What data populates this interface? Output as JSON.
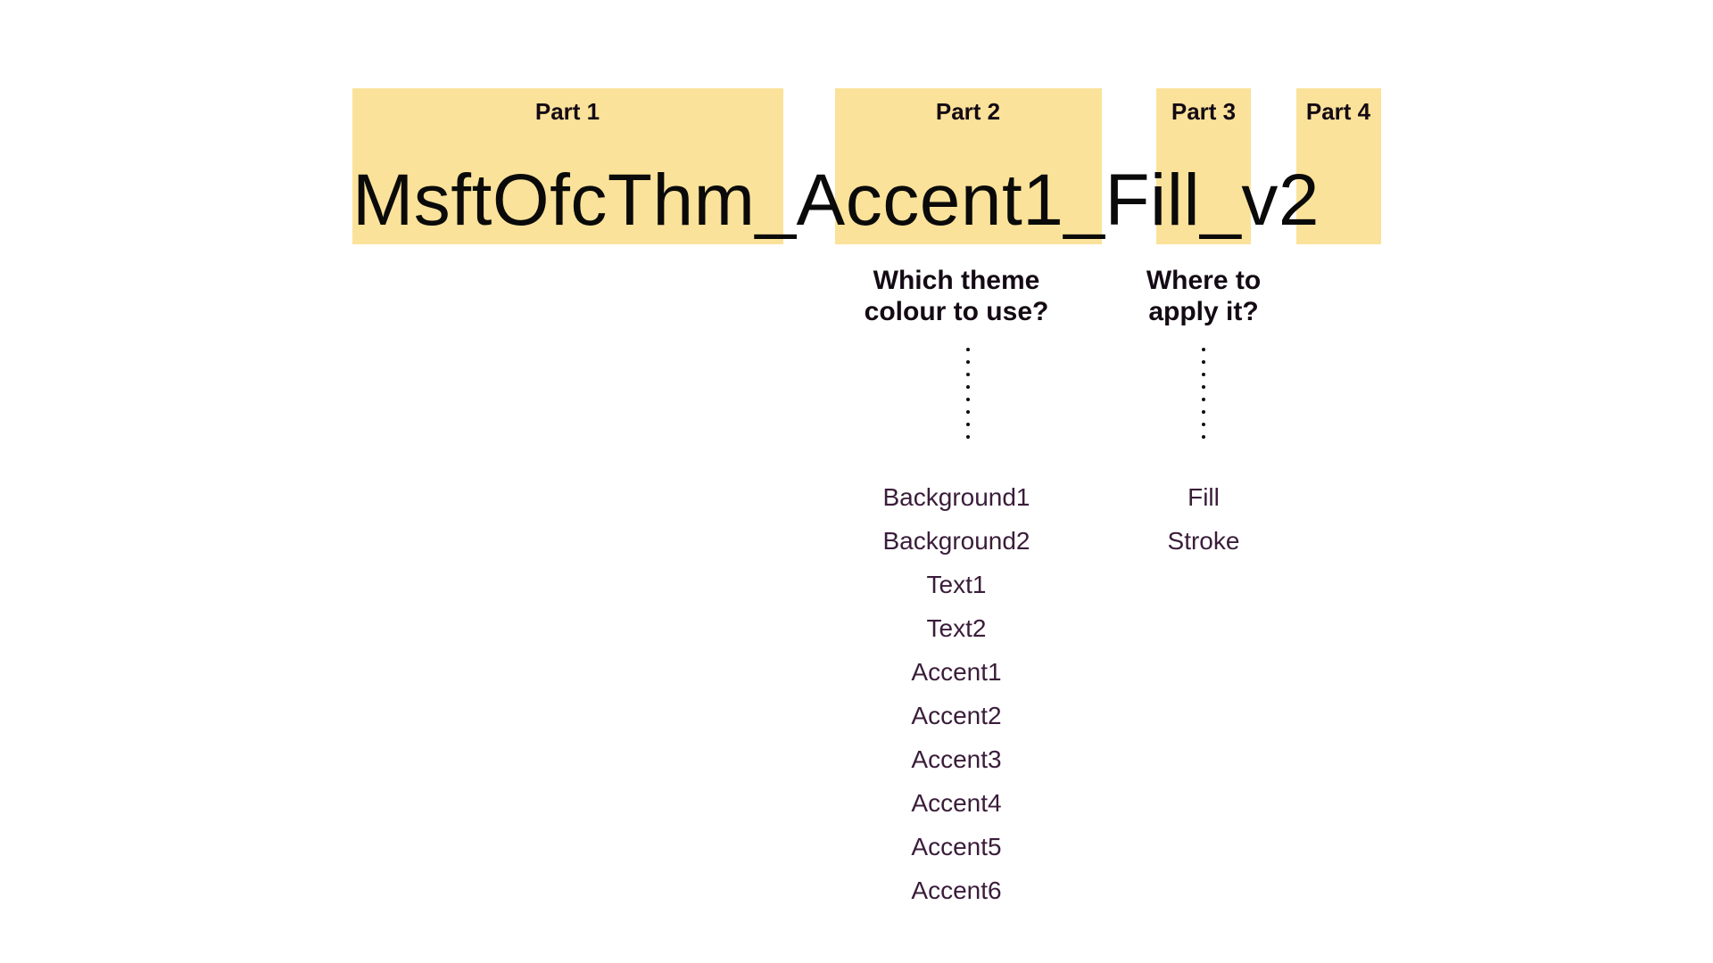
{
  "parts": {
    "p1": {
      "label": "Part 1",
      "segment": "MsftOfcThm"
    },
    "p2": {
      "label": "Part 2",
      "segment": "Accent1"
    },
    "p3": {
      "label": "Part 3",
      "segment": "Fill"
    },
    "p4": {
      "label": "Part 4",
      "segment": "v2"
    }
  },
  "separator": "_",
  "questions": {
    "p2": "Which theme\ncolour to use?",
    "p3": "Where to\napply it?"
  },
  "options": {
    "p2": [
      "Background1",
      "Background2",
      "Text1",
      "Text2",
      "Accent1",
      "Accent2",
      "Accent3",
      "Accent4",
      "Accent5",
      "Accent6"
    ],
    "p3": [
      "Fill",
      "Stroke"
    ]
  },
  "colors": {
    "highlight": "#fbe29a",
    "text_dark": "#140a14",
    "text_option": "#3a1d3a"
  }
}
